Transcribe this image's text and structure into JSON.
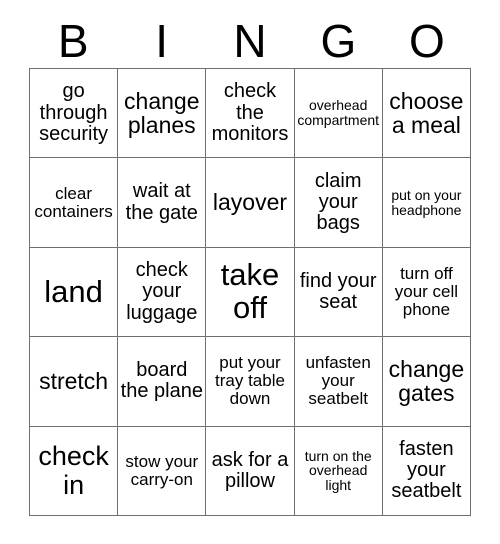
{
  "header": {
    "letters": [
      "B",
      "I",
      "N",
      "G",
      "O"
    ]
  },
  "grid": {
    "columns": 5,
    "rows": 5,
    "border_color": "#6f6f6f",
    "background_color": "#ffffff",
    "text_color": "#000000",
    "cells": [
      {
        "text": "go through security",
        "size": "m"
      },
      {
        "text": "change planes",
        "size": "l"
      },
      {
        "text": "check the monitors",
        "size": "m"
      },
      {
        "text": "overhead compartment",
        "size": "xs"
      },
      {
        "text": "choose a meal",
        "size": "l"
      },
      {
        "text": "clear containers",
        "size": "s"
      },
      {
        "text": "wait at the gate",
        "size": "m"
      },
      {
        "text": "layover",
        "size": "l"
      },
      {
        "text": "claim your bags",
        "size": "m"
      },
      {
        "text": "put on your headphone",
        "size": "xs"
      },
      {
        "text": "land",
        "size": "xxl"
      },
      {
        "text": "check your luggage",
        "size": "m"
      },
      {
        "text": "take off",
        "size": "xxl"
      },
      {
        "text": "find your seat",
        "size": "m"
      },
      {
        "text": "turn off your cell phone",
        "size": "s"
      },
      {
        "text": "stretch",
        "size": "l"
      },
      {
        "text": "board the plane",
        "size": "m"
      },
      {
        "text": "put your tray table down",
        "size": "s"
      },
      {
        "text": "unfasten your seatbelt",
        "size": "s"
      },
      {
        "text": "change gates",
        "size": "l"
      },
      {
        "text": "check in",
        "size": "xl"
      },
      {
        "text": "stow your carry-on",
        "size": "s"
      },
      {
        "text": "ask for a pillow",
        "size": "m"
      },
      {
        "text": "turn on the overhead light",
        "size": "xs"
      },
      {
        "text": "fasten your seatbelt",
        "size": "m"
      }
    ]
  }
}
